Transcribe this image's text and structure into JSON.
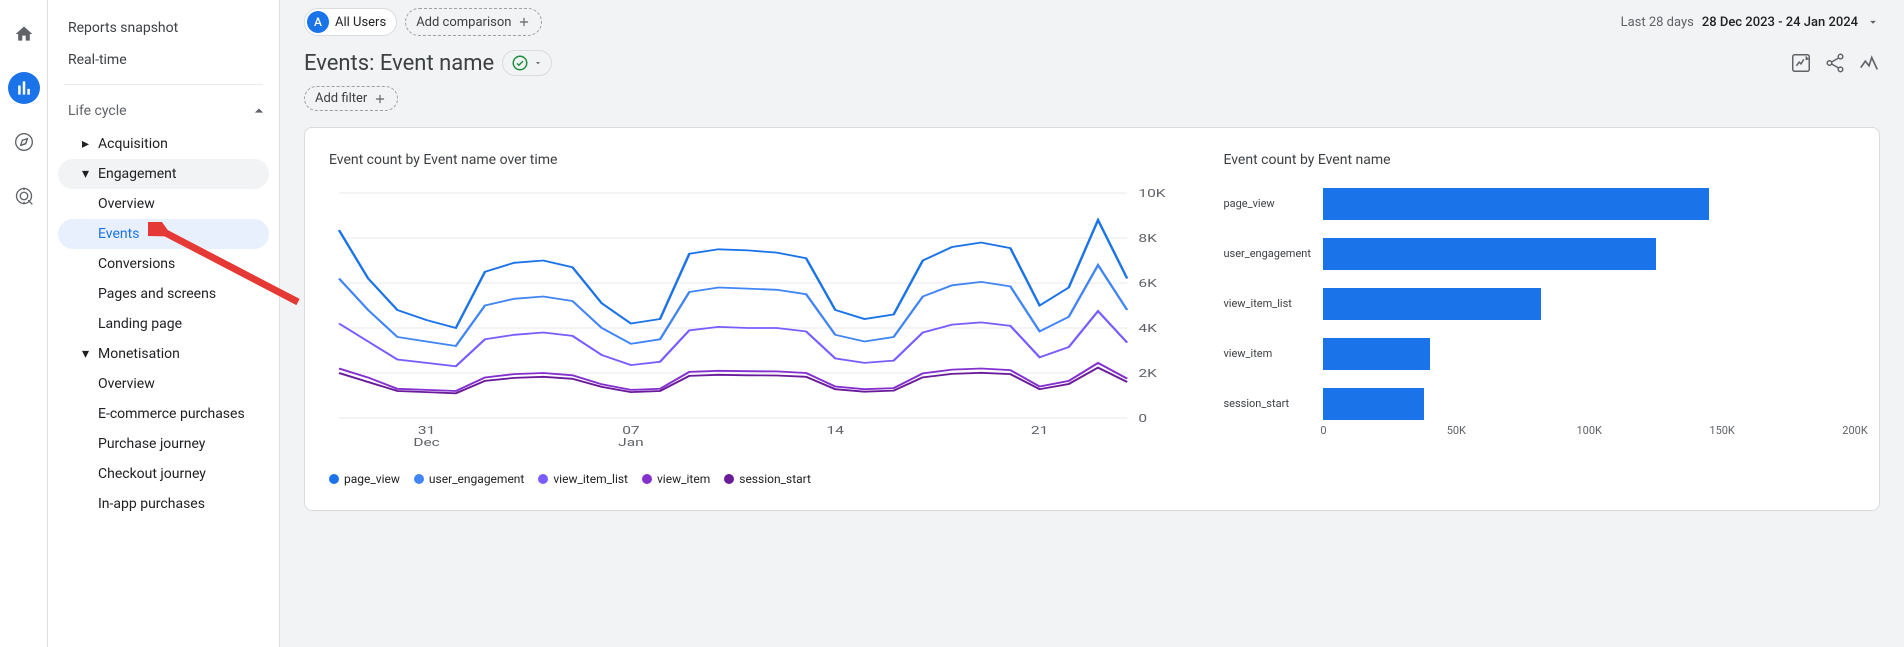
{
  "sidebar": {
    "reports_snapshot": "Reports snapshot",
    "realtime": "Real-time",
    "life_cycle": "Life cycle",
    "acquisition": "Acquisition",
    "engagement": "Engagement",
    "engagement_items": {
      "overview": "Overview",
      "events": "Events",
      "conversions": "Conversions",
      "pages": "Pages and screens",
      "landing": "Landing page"
    },
    "monetisation": "Monetisation",
    "monetisation_items": {
      "overview": "Overview",
      "ecommerce": "E-commerce purchases",
      "purchase_journey": "Purchase journey",
      "checkout_journey": "Checkout journey",
      "inapp": "In-app purchases"
    }
  },
  "header": {
    "audience_letter": "A",
    "audience_label": "All Users",
    "add_comparison": "Add comparison",
    "date_period": "Last 28 days",
    "date_range": "28 Dec 2023 - 24 Jan 2024"
  },
  "title": {
    "page": "Events: Event name",
    "add_filter": "Add filter"
  },
  "chart_data": [
    {
      "type": "line",
      "title": "Event count by Event name over time",
      "ylabel": "",
      "ylim": [
        0,
        10000
      ],
      "y_ticks": [
        "0",
        "2K",
        "4K",
        "6K",
        "8K",
        "10K"
      ],
      "x_ticks": [
        {
          "pos": 3,
          "top": "31",
          "bottom": "Dec"
        },
        {
          "pos": 10,
          "top": "07",
          "bottom": "Jan"
        },
        {
          "pos": 17,
          "top": "14",
          "bottom": ""
        },
        {
          "pos": 24,
          "top": "21",
          "bottom": ""
        }
      ],
      "series": [
        {
          "name": "page_view",
          "color": "#1a73e8",
          "values": [
            8350,
            6200,
            4800,
            4350,
            4000,
            6500,
            6900,
            7000,
            6700,
            5100,
            4200,
            4400,
            7300,
            7500,
            7450,
            7350,
            7100,
            4800,
            4400,
            4600,
            7000,
            7600,
            7800,
            7550,
            5000,
            5800,
            8800,
            6200
          ]
        },
        {
          "name": "user_engagement",
          "color": "#4285f4",
          "values": [
            6200,
            4800,
            3600,
            3400,
            3200,
            5000,
            5300,
            5400,
            5200,
            4000,
            3300,
            3500,
            5600,
            5800,
            5750,
            5700,
            5500,
            3700,
            3400,
            3600,
            5400,
            5900,
            6050,
            5850,
            3850,
            4500,
            6800,
            4800
          ]
        },
        {
          "name": "view_item_list",
          "color": "#7b5cff",
          "values": [
            4200,
            3400,
            2600,
            2450,
            2300,
            3500,
            3700,
            3800,
            3650,
            2800,
            2350,
            2500,
            3900,
            4050,
            4000,
            4000,
            3850,
            2650,
            2450,
            2550,
            3800,
            4150,
            4250,
            4100,
            2700,
            3150,
            4750,
            3350
          ]
        },
        {
          "name": "view_item",
          "color": "#8430ce",
          "values": [
            2200,
            1800,
            1300,
            1250,
            1200,
            1800,
            1950,
            2000,
            1900,
            1500,
            1250,
            1300,
            2050,
            2100,
            2080,
            2070,
            2000,
            1400,
            1280,
            1330,
            1980,
            2150,
            2200,
            2130,
            1400,
            1650,
            2450,
            1750
          ]
        },
        {
          "name": "session_start",
          "color": "#6a1b9a",
          "values": [
            2000,
            1600,
            1200,
            1150,
            1100,
            1650,
            1780,
            1830,
            1740,
            1380,
            1150,
            1200,
            1870,
            1920,
            1900,
            1890,
            1830,
            1280,
            1170,
            1220,
            1810,
            1960,
            2010,
            1950,
            1280,
            1510,
            2240,
            1600
          ]
        }
      ]
    },
    {
      "type": "bar",
      "title": "Event count by Event name",
      "categories": [
        "page_view",
        "user_engagement",
        "view_item_list",
        "view_item",
        "session_start"
      ],
      "values": [
        145000,
        125000,
        82000,
        40000,
        38000
      ],
      "xlim": [
        0,
        200000
      ],
      "x_ticks": [
        {
          "v": 0,
          "label": "0"
        },
        {
          "v": 50000,
          "label": "50K"
        },
        {
          "v": 100000,
          "label": "100K"
        },
        {
          "v": 150000,
          "label": "150K"
        },
        {
          "v": 200000,
          "label": "200K"
        }
      ],
      "color": "#1a73e8"
    }
  ]
}
